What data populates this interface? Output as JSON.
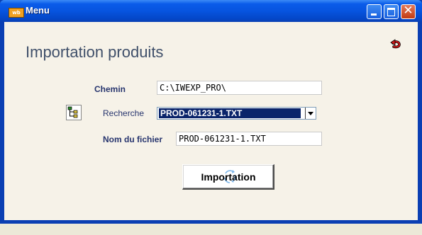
{
  "window": {
    "title": "Menu",
    "app_icon_text": "wb",
    "controls": {
      "minimize_icon": "minimize-icon",
      "maximize_icon": "maximize-icon",
      "close_icon": "close-icon",
      "close_glyph": "✕"
    }
  },
  "form": {
    "heading": "Importation produits",
    "back_icon": "red-return-arrow-icon",
    "chemin": {
      "label": "Chemin",
      "value": "C:\\IWEXP_PRO\\"
    },
    "recherche": {
      "label": "Recherche",
      "selected": "PROD-061231-1.TXT",
      "button_icon": "tree-browse-icon"
    },
    "nom_fichier": {
      "label": "Nom du fichier",
      "value": "PROD-061231-1.TXT"
    },
    "import_button": {
      "label": "Importation",
      "icon": "loading-spinner-icon"
    }
  },
  "colors": {
    "title_bar": "#0754df",
    "client_bg": "#f6f2e8",
    "label_text": "#27356e",
    "selection": "#0a246a",
    "close_button": "#c33b12"
  }
}
